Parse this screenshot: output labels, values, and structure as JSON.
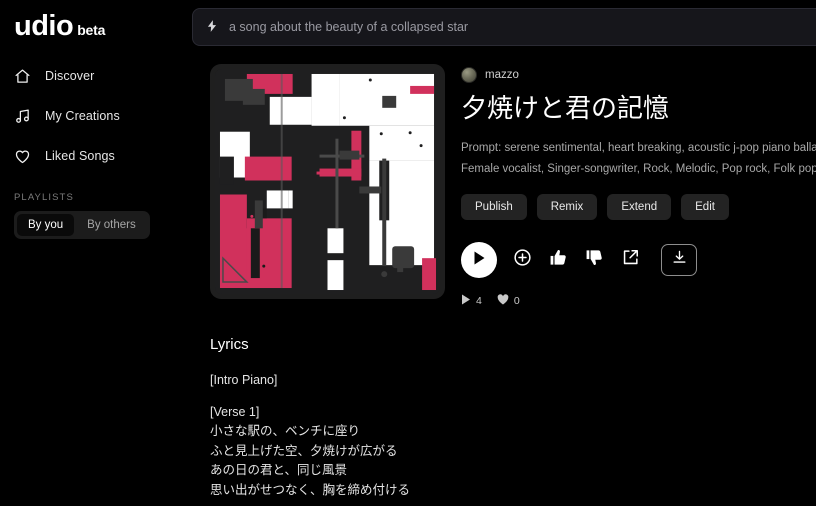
{
  "brand": {
    "name": "udio",
    "tag": "beta"
  },
  "sidebar": {
    "items": [
      {
        "label": "Discover",
        "icon": "home-icon"
      },
      {
        "label": "My Creations",
        "icon": "music-note-icon"
      },
      {
        "label": "Liked Songs",
        "icon": "heart-icon"
      }
    ],
    "playlists_heading": "PLAYLISTS",
    "toggle": {
      "by_you": "By you",
      "by_others": "By others",
      "active": "By you"
    }
  },
  "search": {
    "value": "a song about the beauty of a collapsed star",
    "icon": "lightning-bolt-icon"
  },
  "song": {
    "author": "mazzo",
    "title": "夕焼けと君の記憶",
    "prompt_line1": "Prompt: serene sentimental, heart breaking, acoustic j-pop piano ballad, pedal po",
    "prompt_line2": "Female vocalist, Singer-songwriter, Rock, Melodic, Pop rock, Folk pop, Mellow, S",
    "actions": [
      "Publish",
      "Remix",
      "Extend",
      "Edit"
    ],
    "controls": [
      {
        "name": "play-button",
        "icon": "play-icon"
      },
      {
        "name": "add-button",
        "icon": "plus-circle-icon"
      },
      {
        "name": "like-button",
        "icon": "thumbs-up-icon"
      },
      {
        "name": "dislike-button",
        "icon": "thumbs-down-icon"
      },
      {
        "name": "share-button",
        "icon": "external-link-icon"
      },
      {
        "name": "download-button",
        "icon": "download-icon"
      }
    ],
    "stats": {
      "plays": "4",
      "likes": "0"
    }
  },
  "lyrics": {
    "heading": "Lyrics",
    "lines": [
      "[Intro Piano]",
      "",
      "[Verse 1]",
      "小さな駅の、ベンチに座り",
      "ふと見上げた空、夕焼けが広がる",
      "あの日の君と、同じ風景",
      "思い出がせつなく、胸を締め付ける"
    ]
  },
  "colors": {
    "bg": "#000000",
    "accent_pink": "#d1315c",
    "panel": "#16161b",
    "button": "#232323"
  }
}
